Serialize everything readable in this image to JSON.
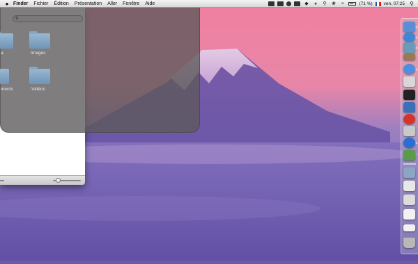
{
  "menubar": {
    "apple": "",
    "app_name": "Finder",
    "items": [
      "Fichier",
      "Édition",
      "Présentation",
      "Aller",
      "Fenêtre",
      "Aide"
    ],
    "status": {
      "battery_text": "(71 %)",
      "clock": "ven. 07:25"
    }
  },
  "overlay": {
    "search_placeholder": "",
    "folders": [
      {
        "label": "a"
      },
      {
        "label": "Images"
      },
      {
        "label": "ments"
      },
      {
        "label": "Vidéos"
      }
    ]
  },
  "dock": {
    "icons": [
      {
        "name": "finder-icon",
        "color": "#5a8fd6"
      },
      {
        "name": "safari-icon",
        "color": "#3f86d4"
      },
      {
        "name": "iphoto-icon",
        "color": "#6b9ab8"
      },
      {
        "name": "contacts-icon",
        "color": "#9a7a55"
      },
      {
        "name": "ichat-icon",
        "color": "#4c8fe0"
      },
      {
        "name": "textedit-icon",
        "color": "#d7d7d7"
      },
      {
        "name": "terminal-icon",
        "color": "#222222"
      },
      {
        "name": "xcode-icon",
        "color": "#3b6fb8"
      },
      {
        "name": "opera-icon",
        "color": "#d4342a"
      },
      {
        "name": "itunes-icon",
        "color": "#c9c9c9"
      },
      {
        "name": "vlc-icon",
        "color": "#2a6ed1"
      },
      {
        "name": "utility-icon",
        "color": "#5a9a4a"
      },
      {
        "name": "downloads-stack-icon",
        "color": "#8aa6c4"
      },
      {
        "name": "document-stack-icon",
        "color": "#e8e8e8"
      },
      {
        "name": "window-stack-icon",
        "color": "#dcdcdc"
      },
      {
        "name": "paper-stack-icon",
        "color": "#f2f2f2"
      },
      {
        "name": "trash-icon",
        "color": "#b8b8b8"
      }
    ]
  }
}
